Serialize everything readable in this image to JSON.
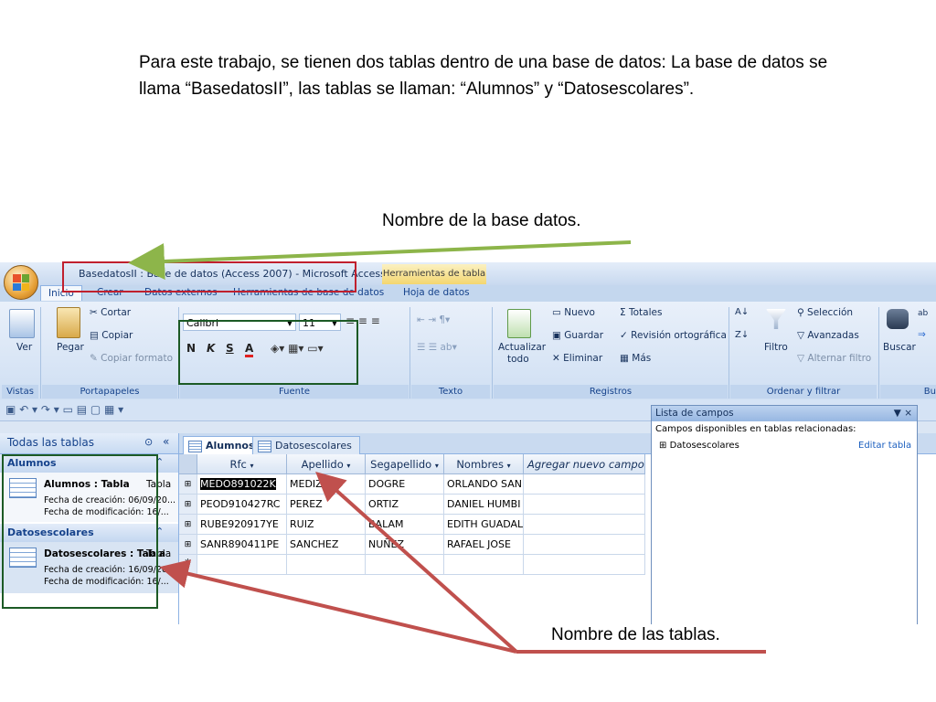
{
  "slide": {
    "paragraph": "Para este trabajo, se tienen dos tablas dentro de una base de datos: La base de datos se llama “BasedatosII”, las tablas se llaman: “Alumnos” y “Datosescolares”.",
    "caption_db": "Nombre de la base datos.",
    "caption_tables": "Nombre de las tablas."
  },
  "window": {
    "title": "BasedatosII : Base de datos (Access 2007) - Microsoft Access",
    "context_tab": "Herramientas de tabla"
  },
  "ribbon_tabs": [
    "Inicio",
    "Crear",
    "Datos externos",
    "Herramientas de base de datos",
    "Hoja de datos"
  ],
  "ribbon": {
    "vistas": {
      "label": "Vistas",
      "ver": "Ver"
    },
    "portapapeles": {
      "label": "Portapapeles",
      "pegar": "Pegar",
      "cortar": "Cortar",
      "copiar": "Copiar",
      "copiar_formato": "Copiar formato"
    },
    "fuente": {
      "label": "Fuente",
      "font": "Calibri",
      "size": "11",
      "bold": "N",
      "italic": "K",
      "underline": "S",
      "color_a": "A"
    },
    "texto": {
      "label": "Texto enriquecido"
    },
    "registros": {
      "label": "Registros",
      "actualizar": "Actualizar",
      "todo": "todo",
      "nuevo": "Nuevo",
      "guardar": "Guardar",
      "eliminar": "Eliminar",
      "totales": "Totales",
      "revision": "Revisión ortográfica",
      "mas": "Más"
    },
    "ordenar": {
      "label": "Ordenar y filtrar",
      "filtro": "Filtro",
      "seleccion": "Selección",
      "avanzadas": "Avanzadas",
      "alternar": "Alternar filtro"
    },
    "buscar": {
      "label": "Bu",
      "buscar": "Buscar"
    }
  },
  "nav": {
    "header": "Todas las tablas",
    "groups": [
      {
        "name": "Alumnos",
        "item": "Alumnos : Tabla",
        "type": "Tabla",
        "created": "Fecha de creación: 06/09/20...",
        "modified": "Fecha de modificación: 16/..."
      },
      {
        "name": "Datosescolares",
        "item": "Datosescolares : Tabla",
        "type": "Tabla",
        "created": "Fecha de creación: 16/09/20...",
        "modified": "Fecha de modificación: 16/..."
      }
    ]
  },
  "doc_tabs": [
    "Alumnos",
    "Datosescolares"
  ],
  "table": {
    "columns": [
      "Rfc",
      "Apellido",
      "Segapellido",
      "Nombres",
      "Agregar nuevo campo"
    ],
    "rows": [
      [
        "MEDO891022K",
        "MEDIZ",
        "DOGRE",
        "ORLANDO SAN"
      ],
      [
        "PEOD910427RC",
        "PEREZ",
        "ORTIZ",
        "DANIEL HUMBI"
      ],
      [
        "RUBE920917YE",
        "RUIZ",
        "BALAM",
        "EDITH GUADAL"
      ],
      [
        "SANR890411PE",
        "SANCHEZ",
        "NUÑEZ",
        "RAFAEL JOSE"
      ]
    ],
    "new_row_marker": "*"
  },
  "field_list": {
    "title": "Lista de campos",
    "close": "▼ ×",
    "heading": "Campos disponibles en tablas relacionadas:",
    "item": "Datosescolares",
    "edit": "Editar tabla"
  }
}
